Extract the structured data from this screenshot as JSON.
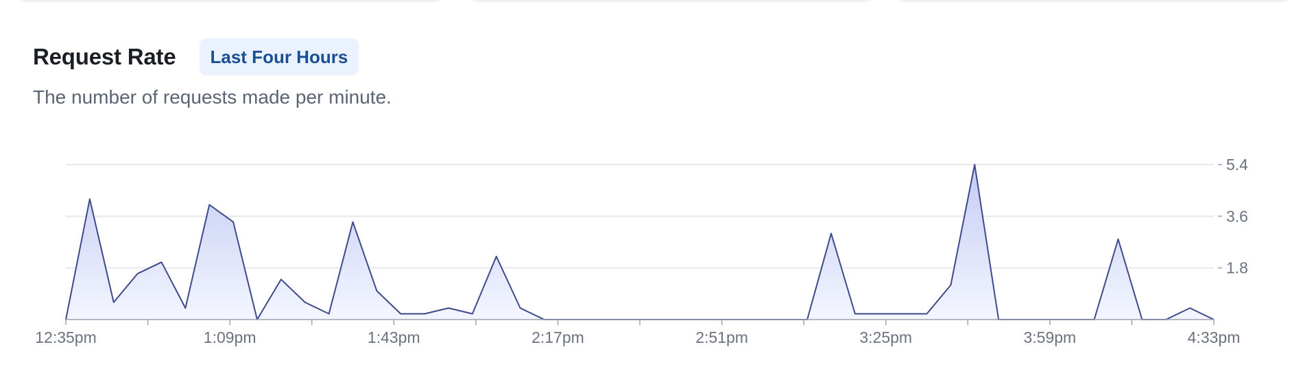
{
  "header": {
    "title": "Request Rate",
    "badge": "Last Four Hours"
  },
  "description": "The number of requests made per minute.",
  "colors": {
    "line": "#3d4a8a",
    "area_top": "#c3cbf3",
    "area_bottom": "#f4f6ff",
    "gridline": "#e5e7eb",
    "axis": "#9ca3af",
    "tick_text": "#6b7280",
    "badge_bg": "#eaf3fd",
    "badge_text": "#1a4f96"
  },
  "chart_data": {
    "type": "area",
    "title": "Request Rate",
    "xlabel": "",
    "ylabel": "",
    "grid": true,
    "ylim": [
      0,
      5.4
    ],
    "yticks": [
      1.8,
      3.6,
      5.4
    ],
    "xticks": [
      "12:35pm",
      "1:09pm",
      "1:43pm",
      "2:17pm",
      "2:51pm",
      "3:25pm",
      "3:59pm",
      "4:33pm"
    ],
    "series": [
      {
        "values": [
          0,
          4.2,
          0.6,
          1.6,
          2.0,
          0.4,
          4.0,
          3.4,
          0,
          1.4,
          0.6,
          0.2,
          3.4,
          1.0,
          0.2,
          0.2,
          0.4,
          0.2,
          2.2,
          0.4,
          0,
          0,
          0,
          0,
          0,
          0,
          0,
          0,
          0,
          0,
          0,
          0,
          3.0,
          0.2,
          0.2,
          0.2,
          0.2,
          1.2,
          5.4,
          0,
          0,
          0,
          0,
          0,
          2.8,
          0,
          0,
          0.4,
          0
        ]
      }
    ]
  }
}
